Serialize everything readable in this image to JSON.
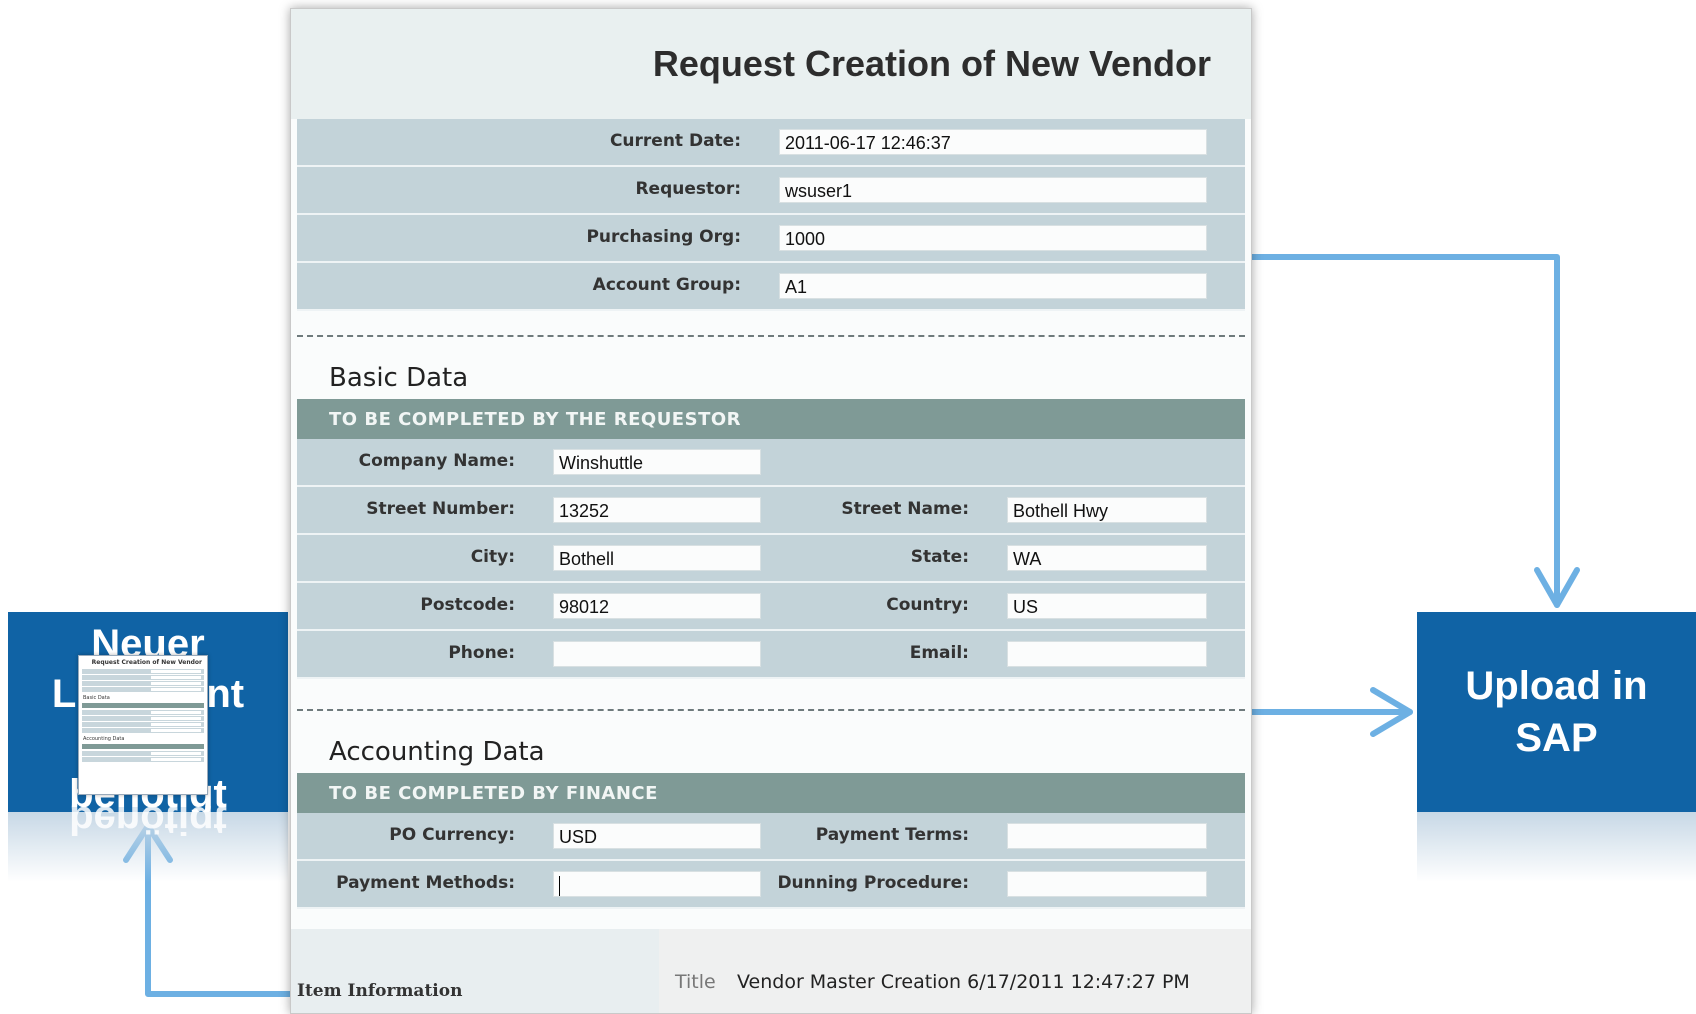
{
  "form": {
    "title": "Request Creation of New Vendor",
    "header_fields": [
      {
        "label": "Current Date:",
        "value": "2011-06-17 12:46:37"
      },
      {
        "label": "Requestor:",
        "value": "wsuser1"
      },
      {
        "label": "Purchasing Org:",
        "value": "1000"
      },
      {
        "label": "Account Group:",
        "value": "A1"
      }
    ],
    "basic_data": {
      "title": "Basic Data",
      "band": "TO BE COMPLETED BY THE REQUESTOR",
      "company_name": {
        "label": "Company Name:",
        "value": "Winshuttle"
      },
      "street_number": {
        "label": "Street Number:",
        "value": "13252"
      },
      "street_name": {
        "label": "Street Name:",
        "value": "Bothell Hwy"
      },
      "city": {
        "label": "City:",
        "value": "Bothell"
      },
      "state": {
        "label": "State:",
        "value": "WA"
      },
      "postcode": {
        "label": "Postcode:",
        "value": "98012"
      },
      "country": {
        "label": "Country:",
        "value": "US"
      },
      "phone": {
        "label": "Phone:",
        "value": ""
      },
      "email": {
        "label": "Email:",
        "value": ""
      }
    },
    "accounting_data": {
      "title": "Accounting Data",
      "band": "TO BE COMPLETED BY FINANCE",
      "po_currency": {
        "label": "PO Currency:",
        "value": "USD"
      },
      "payment_terms": {
        "label": "Payment Terms:",
        "value": ""
      },
      "payment_methods": {
        "label": "Payment Methods:",
        "value": ""
      },
      "dunning_procedure": {
        "label": "Dunning Procedure:",
        "value": ""
      }
    },
    "item_info": {
      "label": "Item Information",
      "key": "Title",
      "value": "Vendor Master Creation 6/17/2011 12:47:27 PM"
    }
  },
  "left_box": {
    "line1": "Neuer",
    "line2_start": "L",
    "line2_end": "nt",
    "line3": "benötigt"
  },
  "right_box": {
    "line1": "Upload in",
    "line2": "SAP"
  },
  "colors": {
    "box_blue": "#1063a5",
    "arrow_blue": "#6db0e3",
    "row_bg": "#c3d3d9",
    "band_bg": "#7f9a96"
  }
}
